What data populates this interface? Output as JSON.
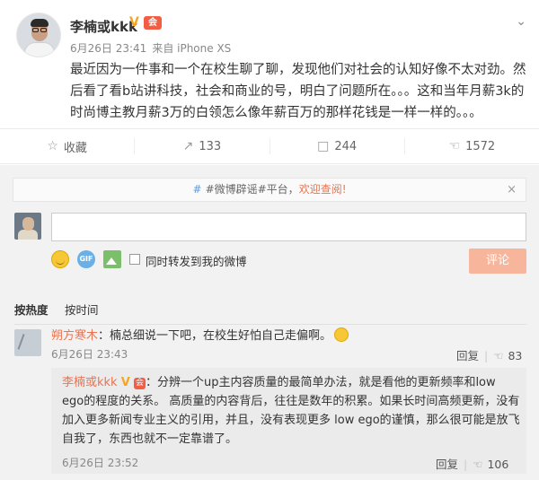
{
  "post": {
    "author": "李楠或kkk",
    "verified_badge": "V",
    "vip_badge": "会",
    "timestamp": "6月26日 23:41",
    "source": "来自 iPhone XS",
    "text": "最近因为一件事和一个在校生聊了聊，发现他们对社会的认知好像不太对劲。然后看了看b站讲科技，社会和商业的号，明白了问题所在。。。这和当年月薪3k的时尚博主教月薪3万的白领怎么像年薪百万的那样花钱是一样一样的。。。",
    "more_icon": "chevron-down-icon"
  },
  "actions": {
    "favorite_label": "收藏",
    "repost_count": "133",
    "comment_count": "244",
    "like_count": "1572"
  },
  "notice": {
    "prefix": "#微博辟谣#平台，",
    "link": "欢迎查阅!",
    "close": "×"
  },
  "composer": {
    "repost_label": "同时转发到我的微博",
    "submit_label": "评论"
  },
  "sort": {
    "hot_label": "按热度",
    "time_label": "按时间"
  },
  "comments": [
    {
      "nick": "朔方寒木",
      "text": "：楠总细说一下吧，在校生好怕自己走偏啊。",
      "time": "6月26日 23:43",
      "reply_label": "回复",
      "likes": "83",
      "reply": {
        "nick": "李楠或kkk",
        "verified_badge": "V",
        "vip_badge": "会",
        "text": "：分辨一个up主内容质量的最简单办法，就是看他的更新频率和low ego的程度的关系。 高质量的内容背后，往往是数年的积累。如果长时间高频更新，没有加入更多新闻专业主义的引用，并且，没有表现更多 low ego的谨慎，那么很可能是放飞自我了，东西也就不一定靠谱了。",
        "time": "6月26日 23:52",
        "reply_label": "回复",
        "likes": "106"
      }
    }
  ]
}
